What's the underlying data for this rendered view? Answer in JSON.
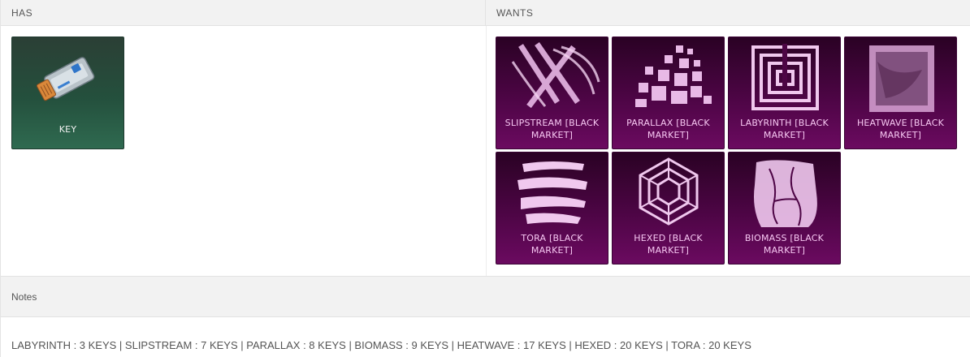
{
  "has": {
    "header": "HAS",
    "items": [
      {
        "name": "KEY",
        "icon": "key-icon"
      }
    ]
  },
  "wants": {
    "header": "WANTS",
    "items": [
      {
        "name": "SLIPSTREAM [BLACK MARKET]",
        "icon": "slipstream-decal-icon"
      },
      {
        "name": "PARALLAX [BLACK MARKET]",
        "icon": "parallax-decal-icon"
      },
      {
        "name": "LABYRINTH [BLACK MARKET]",
        "icon": "labyrinth-decal-icon"
      },
      {
        "name": "HEATWAVE [BLACK MARKET]",
        "icon": "heatwave-decal-icon"
      },
      {
        "name": "TORA [BLACK MARKET]",
        "icon": "tora-decal-icon"
      },
      {
        "name": "HEXED [BLACK MARKET]",
        "icon": "hexed-decal-icon"
      },
      {
        "name": "BIOMASS [BLACK MARKET]",
        "icon": "biomass-decal-icon"
      }
    ]
  },
  "notes": {
    "header": "Notes",
    "text": "LABYRINTH : 3 KEYS | SLIPSTREAM : 7 KEYS | PARALLAX : 8 KEYS | BIOMASS : 9 KEYS | HEATWAVE : 17 KEYS | HEXED : 20 KEYS | TORA : 20 KEYS"
  },
  "colors": {
    "black_market_bg": "#4d0545",
    "black_market_label": "#f7c7f2",
    "key_bg": "#24503d",
    "header_bg": "#f2f2f2"
  }
}
